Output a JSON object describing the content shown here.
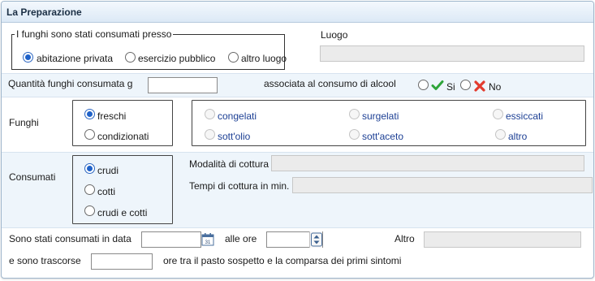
{
  "panel": {
    "title": "La Preparazione"
  },
  "consumo": {
    "legend": "I funghi sono stati consumati presso",
    "options": [
      "abitazione privata",
      "esercizio pubblico",
      "altro luogo"
    ]
  },
  "luogo": {
    "label": "Luogo",
    "value": ""
  },
  "quantita": {
    "label": "Quantità funghi consumata g",
    "value": "",
    "alcool_label": "associata al consumo di alcool",
    "si": "Si",
    "no": "No"
  },
  "funghi": {
    "label": "Funghi",
    "stato": [
      "freschi",
      "condizionati"
    ],
    "tipo": [
      "congelati",
      "surgelati",
      "essiccati",
      "sott'olio",
      "sott'aceto",
      "altro"
    ]
  },
  "consumati": {
    "label": "Consumati",
    "options": [
      "crudi",
      "cotti",
      "crudi e cotti"
    ],
    "modalita_label": "Modalità di cottura",
    "tempi_label": "Tempi di cottura in min."
  },
  "data": {
    "label": "Sono stati consumati in data",
    "ore_label": "alle ore",
    "altro_label": "Altro",
    "trascorse_label": "e sono trascorse",
    "ore_tra_label": "ore tra il pasto sospetto e la comparsa dei primi sintomi"
  },
  "colors": {
    "header": "#dce9f6",
    "row_highlight": "#eef5fb",
    "accent": "#1f62c9",
    "si_check": "#2ea53a",
    "no_cross": "#e23b2e"
  },
  "icons": [
    "calendar-icon",
    "spinner-icon",
    "check-icon",
    "cross-icon"
  ]
}
